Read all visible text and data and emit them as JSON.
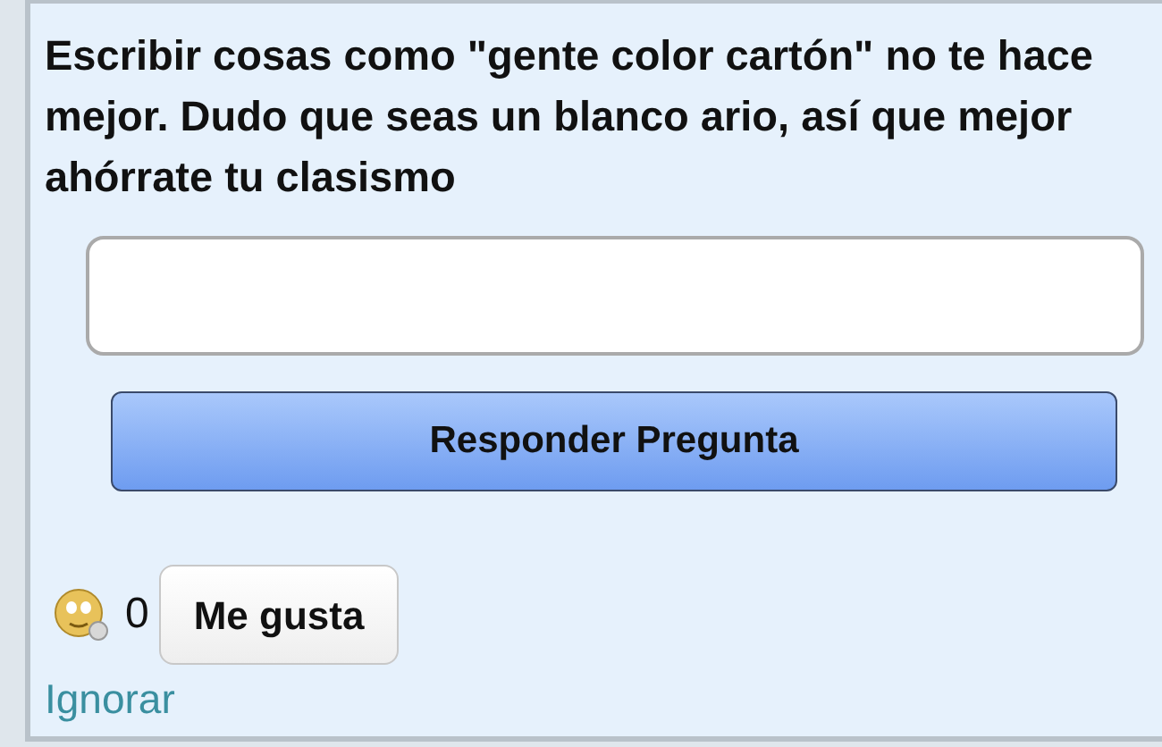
{
  "question": {
    "text": "Escribir cosas como \"gente color cartón\" no te hace mejor. Dudo que seas un blanco ario, así que mejor ahórrate tu clasismo"
  },
  "answer_button": {
    "label": "Responder Pregunta"
  },
  "likes": {
    "count": "0",
    "button": "Me gusta"
  },
  "ignore_link": {
    "label": "Ignorar"
  }
}
